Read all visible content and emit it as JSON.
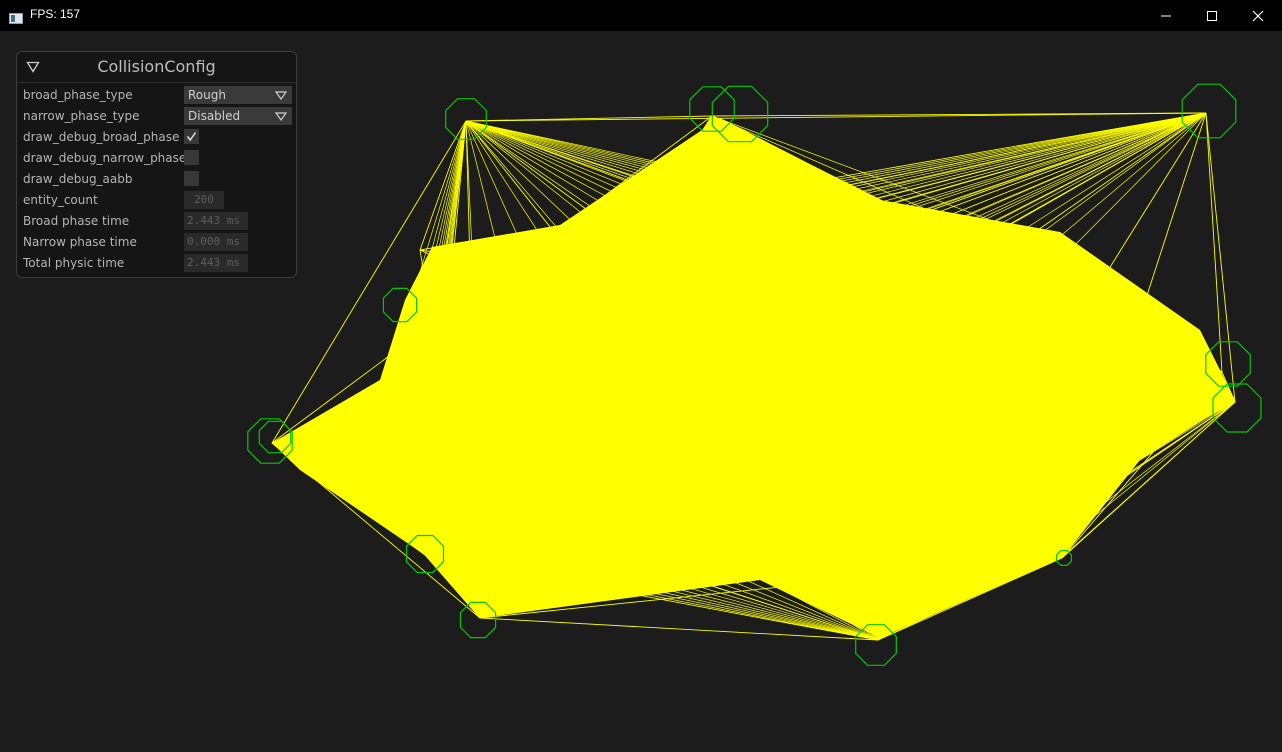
{
  "window": {
    "title": "FPS: 157"
  },
  "panel": {
    "title": "CollisionConfig",
    "broad_phase_type": {
      "label": "broad_phase_type",
      "value": "Rough"
    },
    "narrow_phase_type": {
      "label": "narrow_phase_type",
      "value": "Disabled"
    },
    "draw_debug_broad_phase": {
      "label": "draw_debug_broad_phase",
      "checked": true
    },
    "draw_debug_narrow_phase": {
      "label": "draw_debug_narrow_phase",
      "checked": false
    },
    "draw_debug_aabb": {
      "label": "draw_debug_aabb",
      "checked": false
    },
    "entity_count": {
      "label": "entity_count",
      "value": "200"
    },
    "broad_phase_time": {
      "label": "Broad phase time",
      "value": "2.443 ms"
    },
    "narrow_phase_time": {
      "label": "Narrow phase time",
      "value": "0.000 ms"
    },
    "total_physic_time": {
      "label": "Total physic time",
      "value": "2.443 ms"
    }
  },
  "colors": {
    "title_bar": "#000000",
    "background": "#1c1c1c",
    "broad_phase_lines": "#ffff00",
    "entity_outline": "#00c800"
  },
  "icons": {
    "window": "app-window-icon",
    "collapse": "triangle-down-icon",
    "combo": "triangle-down-icon",
    "check": "checkmark-icon"
  }
}
